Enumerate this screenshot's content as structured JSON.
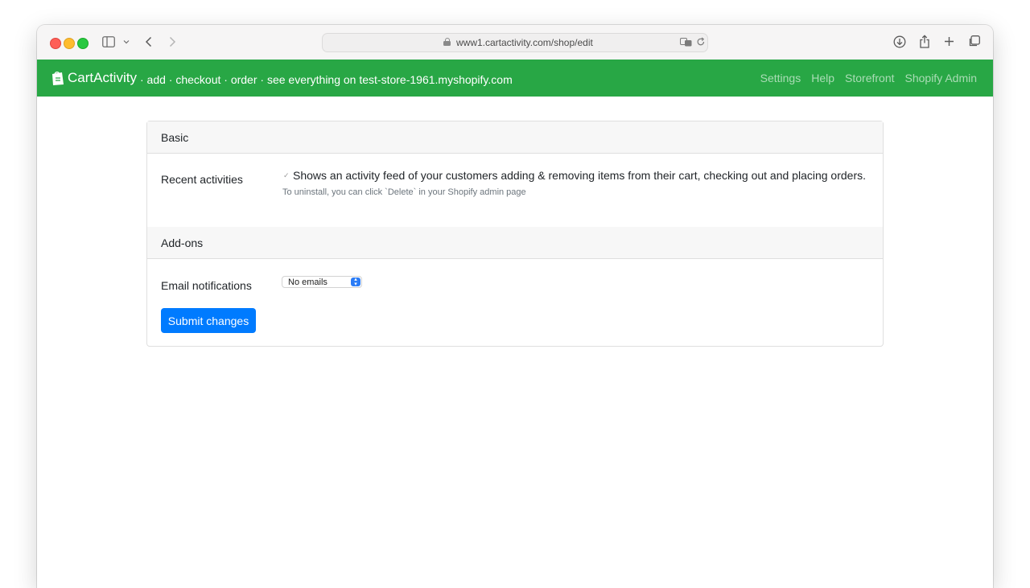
{
  "browser": {
    "url": "www1.cartactivity.com/shop/edit"
  },
  "navbar": {
    "brand": "CartActivity",
    "tagline": "· add · checkout · order · see everything on test-store-1961.myshopify.com",
    "links": [
      "Settings",
      "Help",
      "Storefront",
      "Shopify Admin"
    ],
    "color": "#28a745"
  },
  "form": {
    "sections": [
      {
        "title": "Basic"
      },
      {
        "title": "Add-ons"
      }
    ],
    "recent_activities": {
      "label": "Recent activities",
      "description": "Shows an activity feed of your customers adding & removing items from their cart, checking out and placing orders.",
      "hint": "To uninstall, you can click `Delete` in your Shopify admin page"
    },
    "email_notifications": {
      "label": "Email notifications",
      "selected": "No emails"
    },
    "submit_label": "Submit changes"
  }
}
